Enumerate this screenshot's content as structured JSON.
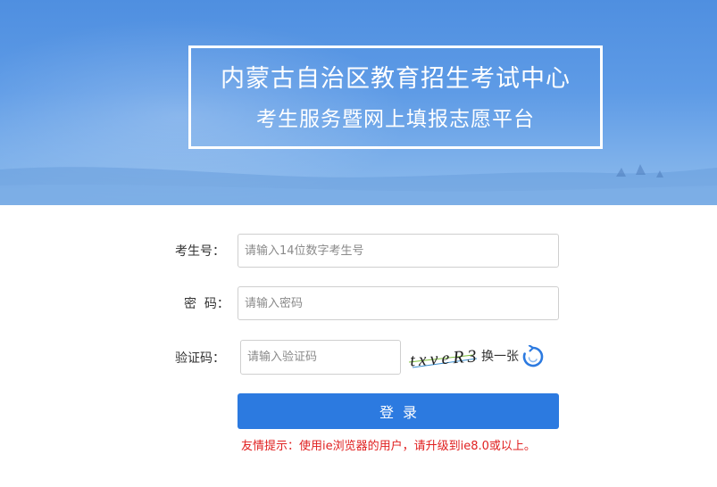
{
  "banner": {
    "title_line1": "内蒙古自治区教育招生考试中心",
    "title_line2": "考生服务暨网上填报志愿平台"
  },
  "form": {
    "exam_id_label": "考生号：",
    "exam_id_placeholder": "请输入14位数字考生号",
    "password_label": "密  码：",
    "password_placeholder": "请输入密码",
    "captcha_label": "验证码：",
    "captcha_placeholder": "请输入验证码",
    "captcha_text": "txveR3",
    "refresh_label": "换一张",
    "login_button": "登录",
    "tip": "友情提示：使用ie浏览器的用户，请升级到ie8.0或以上。"
  },
  "colors": {
    "accent": "#2c7ae0",
    "tip": "#e02020",
    "banner": "#5e9be6"
  }
}
